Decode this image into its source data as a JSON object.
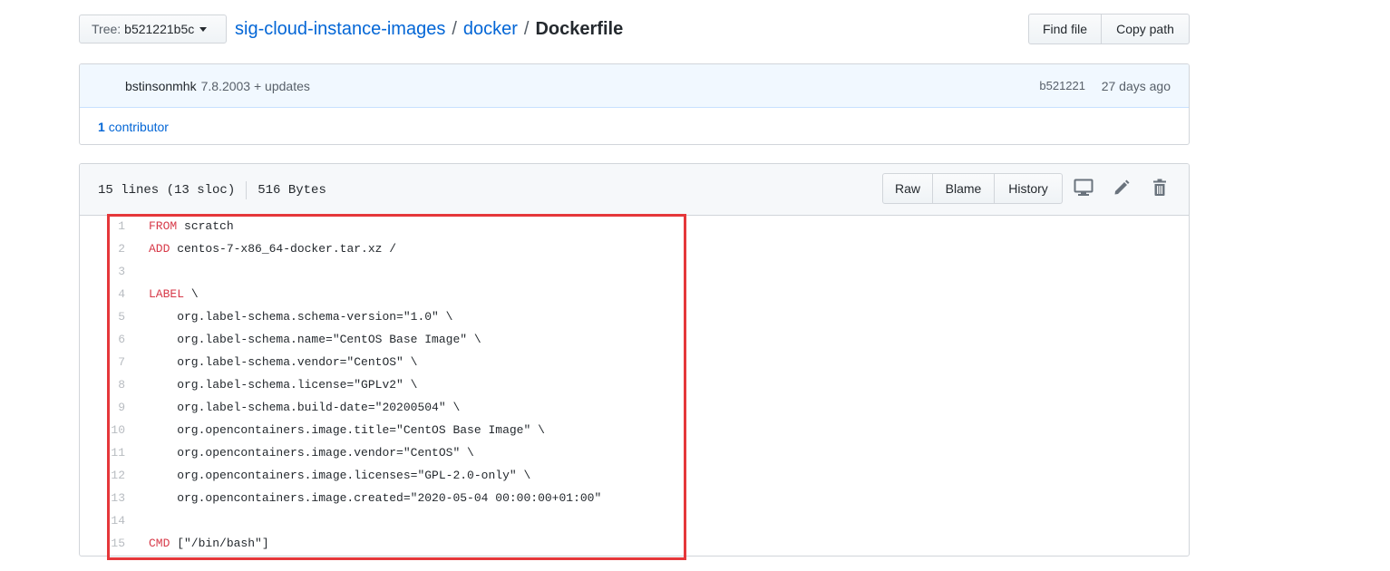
{
  "tree_button": {
    "prefix": "Tree:",
    "value": "b521221b5c"
  },
  "breadcrumb": {
    "repo": "sig-cloud-instance-images",
    "sep1": "/",
    "folder": "docker",
    "sep2": "/",
    "file": "Dockerfile"
  },
  "header_buttons": {
    "find_file": "Find file",
    "copy_path": "Copy path"
  },
  "commit": {
    "author": "bstinsonmhk",
    "message": "7.8.2003 + updates",
    "sha": "b521221",
    "age": "27 days ago",
    "contributors_count": "1",
    "contributors_label": "contributor"
  },
  "file": {
    "lines_info": "15 lines (13 sloc)",
    "size": "516 Bytes",
    "raw_label": "Raw",
    "blame_label": "Blame",
    "history_label": "History"
  },
  "code_lines": [
    {
      "num": "1",
      "kw": "FROM",
      "rest": " scratch"
    },
    {
      "num": "2",
      "kw": "ADD",
      "rest": " centos-7-x86_64-docker.tar.xz /"
    },
    {
      "num": "3",
      "kw": "",
      "rest": ""
    },
    {
      "num": "4",
      "kw": "LABEL",
      "rest": " \\"
    },
    {
      "num": "5",
      "kw": "",
      "rest": "    org.label-schema.schema-version=\"1.0\" \\"
    },
    {
      "num": "6",
      "kw": "",
      "rest": "    org.label-schema.name=\"CentOS Base Image\" \\"
    },
    {
      "num": "7",
      "kw": "",
      "rest": "    org.label-schema.vendor=\"CentOS\" \\"
    },
    {
      "num": "8",
      "kw": "",
      "rest": "    org.label-schema.license=\"GPLv2\" \\"
    },
    {
      "num": "9",
      "kw": "",
      "rest": "    org.label-schema.build-date=\"20200504\" \\"
    },
    {
      "num": "10",
      "kw": "",
      "rest": "    org.opencontainers.image.title=\"CentOS Base Image\" \\"
    },
    {
      "num": "11",
      "kw": "",
      "rest": "    org.opencontainers.image.vendor=\"CentOS\" \\"
    },
    {
      "num": "12",
      "kw": "",
      "rest": "    org.opencontainers.image.licenses=\"GPL-2.0-only\" \\"
    },
    {
      "num": "13",
      "kw": "",
      "rest": "    org.opencontainers.image.created=\"2020-05-04 00:00:00+01:00\""
    },
    {
      "num": "14",
      "kw": "",
      "rest": ""
    },
    {
      "num": "15",
      "kw": "CMD",
      "rest": " [\"/bin/bash\"]"
    }
  ],
  "colors": {
    "link": "#0366d6",
    "keyword": "#d73a49",
    "highlight_border": "#e5373a"
  }
}
